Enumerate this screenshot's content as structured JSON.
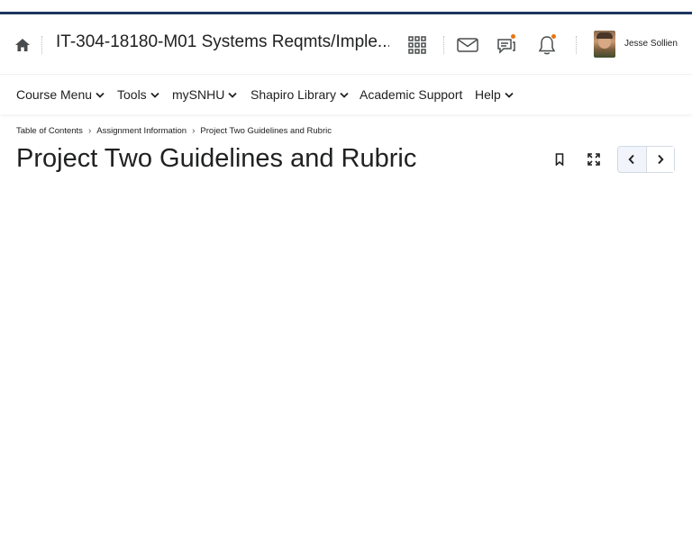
{
  "header": {
    "course_title": "IT-304-18180-M01 Systems Reqmts/Imple...",
    "user_name": "Jesse Sollien",
    "icons": [
      "home-icon",
      "waffle-grid-icon",
      "mail-icon",
      "chat-icon",
      "bell-icon"
    ],
    "badge_color": "#e87511"
  },
  "nav": {
    "items": [
      {
        "label": "Course Menu",
        "has_dropdown": true
      },
      {
        "label": "Tools",
        "has_dropdown": true
      },
      {
        "label": "mySNHU",
        "has_dropdown": true
      },
      {
        "label": "Shapiro Library",
        "has_dropdown": true
      },
      {
        "label": "Academic Support",
        "has_dropdown": false
      },
      {
        "label": "Help",
        "has_dropdown": true
      }
    ]
  },
  "breadcrumb": {
    "items": [
      "Table of Contents",
      "Assignment Information",
      "Project Two Guidelines and Rubric"
    ],
    "separator": "›"
  },
  "page": {
    "title": "Project Two Guidelines and Rubric"
  },
  "colors": {
    "top_stripe": "#1c3660",
    "text": "#202122"
  }
}
